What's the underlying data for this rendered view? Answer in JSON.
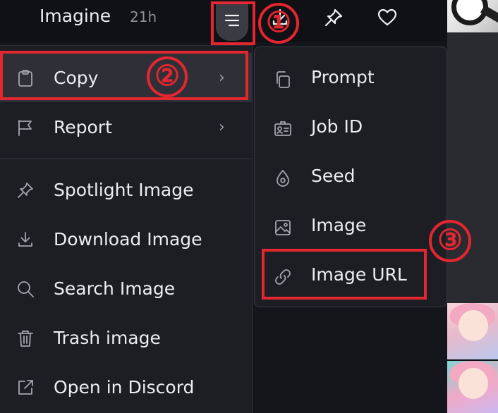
{
  "header": {
    "title": "Imagine",
    "time": "21h",
    "icons": [
      "menu-icon",
      "download-icon",
      "pin-icon",
      "heart-icon"
    ]
  },
  "annotations": {
    "step1": "①",
    "step2": "②",
    "step3": "③",
    "highlight_color": "#e3262f"
  },
  "menu": {
    "copy": "Copy",
    "report": "Report",
    "spotlight": "Spotlight Image",
    "download": "Download Image",
    "search": "Search Image",
    "trash": "Trash image",
    "discord": "Open in Discord",
    "chevron": "›"
  },
  "submenu": {
    "prompt": "Prompt",
    "job_id": "Job ID",
    "seed": "Seed",
    "image": "Image",
    "image_url": "Image URL"
  },
  "colors": {
    "background": "#15161b",
    "menu_bg": "#1d1e24",
    "active_item_bg": "#2f3037"
  }
}
